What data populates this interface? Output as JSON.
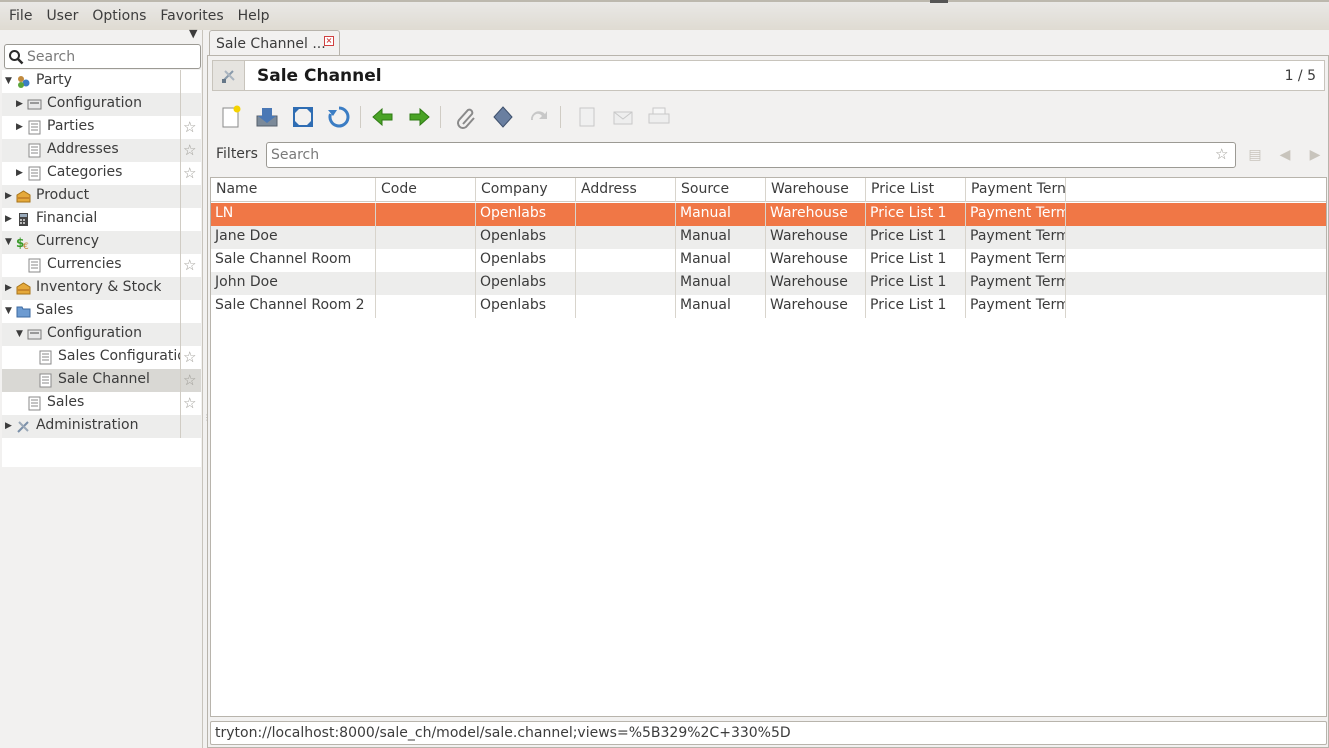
{
  "menubar": {
    "items": [
      "File",
      "User",
      "Options",
      "Favorites",
      "Help"
    ]
  },
  "sidebar": {
    "search_placeholder": "Search",
    "tree": [
      {
        "label": "Party",
        "level": 0,
        "expanded": true,
        "icon": "party-icon"
      },
      {
        "label": "Configuration",
        "level": 1,
        "expanded": false,
        "icon": "config-icon"
      },
      {
        "label": "Parties",
        "level": 1,
        "expanded": false,
        "icon": "list-icon",
        "favorite": true
      },
      {
        "label": "Addresses",
        "level": 1,
        "icon": "list-icon",
        "favorite": true
      },
      {
        "label": "Categories",
        "level": 1,
        "expanded": false,
        "icon": "list-icon",
        "favorite": true
      },
      {
        "label": "Product",
        "level": 0,
        "expanded": false,
        "icon": "product-icon"
      },
      {
        "label": "Financial",
        "level": 0,
        "expanded": false,
        "icon": "financial-icon"
      },
      {
        "label": "Currency",
        "level": 0,
        "expanded": true,
        "icon": "currency-icon"
      },
      {
        "label": "Currencies",
        "level": 1,
        "icon": "list-icon",
        "favorite": true
      },
      {
        "label": "Inventory & Stock",
        "level": 0,
        "expanded": false,
        "icon": "inventory-icon"
      },
      {
        "label": "Sales",
        "level": 0,
        "expanded": true,
        "icon": "sales-icon"
      },
      {
        "label": "Configuration",
        "level": 1,
        "expanded": true,
        "icon": "config-icon"
      },
      {
        "label": "Sales Configuration",
        "level": 2,
        "icon": "list-icon",
        "favorite": true
      },
      {
        "label": "Sale Channel",
        "level": 2,
        "icon": "list-icon",
        "favorite": true,
        "selected": true
      },
      {
        "label": "Sales",
        "level": 1,
        "icon": "list-icon",
        "favorite": true
      },
      {
        "label": "Administration",
        "level": 0,
        "expanded": false,
        "icon": "admin-icon"
      }
    ]
  },
  "tab": {
    "label": "Sale Channel ..."
  },
  "form": {
    "title": "Sale Channel",
    "record_count": "1 / 5"
  },
  "filters": {
    "label": "Filters",
    "placeholder": "Search"
  },
  "grid": {
    "columns": [
      "Name",
      "Code",
      "Company",
      "Address",
      "Source",
      "Warehouse",
      "Price List",
      "Payment Tern"
    ],
    "rows": [
      [
        "LN",
        "",
        "Openlabs",
        "",
        "Manual",
        "Warehouse",
        "Price List 1",
        "Payment Term"
      ],
      [
        "Jane Doe",
        "",
        "Openlabs",
        "",
        "Manual",
        "Warehouse",
        "Price List 1",
        "Payment Term"
      ],
      [
        "Sale Channel Room",
        "",
        "Openlabs",
        "",
        "Manual",
        "Warehouse",
        "Price List 1",
        "Payment Term"
      ],
      [
        "John Doe",
        "",
        "Openlabs",
        "",
        "Manual",
        "Warehouse",
        "Price List 1",
        "Payment Term"
      ],
      [
        "Sale Channel Room 2",
        "",
        "Openlabs",
        "",
        "Manual",
        "Warehouse",
        "Price List 1",
        "Payment Term"
      ]
    ],
    "selected_row": 0
  },
  "status": {
    "url": "tryton://localhost:8000/sale_ch/model/sale.channel;views=%5B329%2C+330%5D"
  },
  "colors": {
    "selection": "#f07746",
    "alt_row": "#ededec"
  }
}
